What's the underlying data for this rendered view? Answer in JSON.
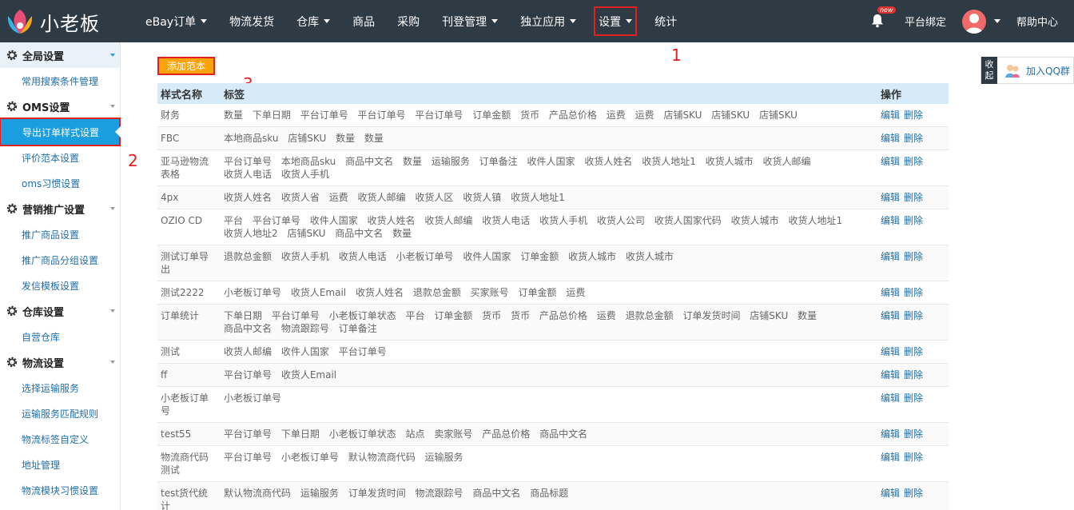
{
  "brand": {
    "name": "小老板"
  },
  "nav": {
    "items": [
      {
        "label": "eBay订单",
        "caret": true
      },
      {
        "label": "物流发货",
        "caret": false
      },
      {
        "label": "仓库",
        "caret": true
      },
      {
        "label": "商品",
        "caret": false
      },
      {
        "label": "采购",
        "caret": false
      },
      {
        "label": "刊登管理",
        "caret": true
      },
      {
        "label": "独立应用",
        "caret": true
      },
      {
        "label": "设置",
        "caret": true
      },
      {
        "label": "统计",
        "caret": false
      }
    ],
    "new_badge": "new",
    "platform_bind": "平台绑定",
    "help": "帮助中心"
  },
  "annotations": {
    "a1": "1",
    "a2": "2",
    "a3": "3"
  },
  "sidebar": {
    "sections": [
      {
        "title": "全局设置",
        "items": [
          "常用搜索条件管理"
        ]
      },
      {
        "title": "OMS设置",
        "items": [
          "导出订单样式设置",
          "评价范本设置",
          "oms习惯设置"
        ]
      },
      {
        "title": "营销推广设置",
        "items": [
          "推广商品设置",
          "推广商品分组设置",
          "发信模板设置"
        ]
      },
      {
        "title": "仓库设置",
        "items": [
          "自营仓库"
        ]
      },
      {
        "title": "物流设置",
        "items": [
          "选择运输服务",
          "运输服务匹配规则",
          "物流标签自定义",
          "地址管理",
          "物流模块习惯设置"
        ]
      }
    ]
  },
  "main": {
    "add_button": "添加范本",
    "columns": {
      "name": "样式名称",
      "tags": "标签",
      "ops": "操作"
    },
    "edit": "编辑",
    "delete": "删除",
    "rows": [
      {
        "name": "财务",
        "tags": [
          "数量",
          "下单日期",
          "平台订单号",
          "平台订单号",
          "平台订单号",
          "订单金额",
          "货币",
          "产品总价格",
          "运费",
          "运费",
          "店铺SKU",
          "店铺SKU",
          "店铺SKU"
        ]
      },
      {
        "name": "FBC",
        "tags": [
          "本地商品sku",
          "店铺SKU",
          "数量",
          "数量"
        ]
      },
      {
        "name": "亚马逊物流表格",
        "tags": [
          "平台订单号",
          "本地商品sku",
          "商品中文名",
          "数量",
          "运输服务",
          "订单备注",
          "收件人国家",
          "收货人姓名",
          "收货人地址1",
          "收货人城市",
          "收货人邮编",
          "收货人电话",
          "收货人手机"
        ]
      },
      {
        "name": "4px",
        "tags": [
          "收货人姓名",
          "收货人省",
          "运费",
          "收货人邮编",
          "收货人区",
          "收货人镇",
          "收货人地址1"
        ]
      },
      {
        "name": "OZIO CD",
        "tags": [
          "平台",
          "平台订单号",
          "收件人国家",
          "收货人姓名",
          "收货人邮编",
          "收货人电话",
          "收货人手机",
          "收货人公司",
          "收货人国家代码",
          "收货人城市",
          "收货人地址1",
          "收货人地址2",
          "店铺SKU",
          "商品中文名",
          "数量"
        ]
      },
      {
        "name": "测试订单导出",
        "tags": [
          "退款总金额",
          "收货人手机",
          "收货人电话",
          "小老板订单号",
          "收件人国家",
          "订单金额",
          "收货人城市",
          "收货人城市"
        ]
      },
      {
        "name": "测试2222",
        "tags": [
          "小老板订单号",
          "收货人Email",
          "收货人姓名",
          "退款总金额",
          "买家账号",
          "订单金额",
          "运费"
        ]
      },
      {
        "name": "订单统计",
        "tags": [
          "下单日期",
          "平台订单号",
          "小老板订单状态",
          "平台",
          "订单金额",
          "货币",
          "货币",
          "产品总价格",
          "运费",
          "退款总金额",
          "订单发货时间",
          "店铺SKU",
          "数量",
          "商品中文名",
          "物流跟踪号",
          "订单备注"
        ]
      },
      {
        "name": "测试",
        "tags": [
          "收货人邮编",
          "收件人国家",
          "平台订单号"
        ]
      },
      {
        "name": "ff",
        "tags": [
          "平台订单号",
          "收货人Email"
        ]
      },
      {
        "name": "小老板订单号",
        "tags": [
          "小老板订单号"
        ]
      },
      {
        "name": "test55",
        "tags": [
          "平台订单号",
          "下单日期",
          "小老板订单状态",
          "站点",
          "卖家账号",
          "产品总价格",
          "商品中文名"
        ]
      },
      {
        "name": "物流商代码测试",
        "tags": [
          "平台订单号",
          "小老板订单号",
          "默认物流商代码",
          "运输服务"
        ]
      },
      {
        "name": "test货代统计",
        "tags": [
          "默认物流商代码",
          "运输服务",
          "订单发货时间",
          "物流跟踪号",
          "商品中文名",
          "商品标题"
        ]
      }
    ]
  },
  "qq": {
    "collapse": "收起",
    "label": "加入QQ群"
  },
  "colors": {
    "topbar": "#2e3a44",
    "accent": "#1a9ee0",
    "add_button": "#f7a30a",
    "annotation": "#e02020"
  }
}
